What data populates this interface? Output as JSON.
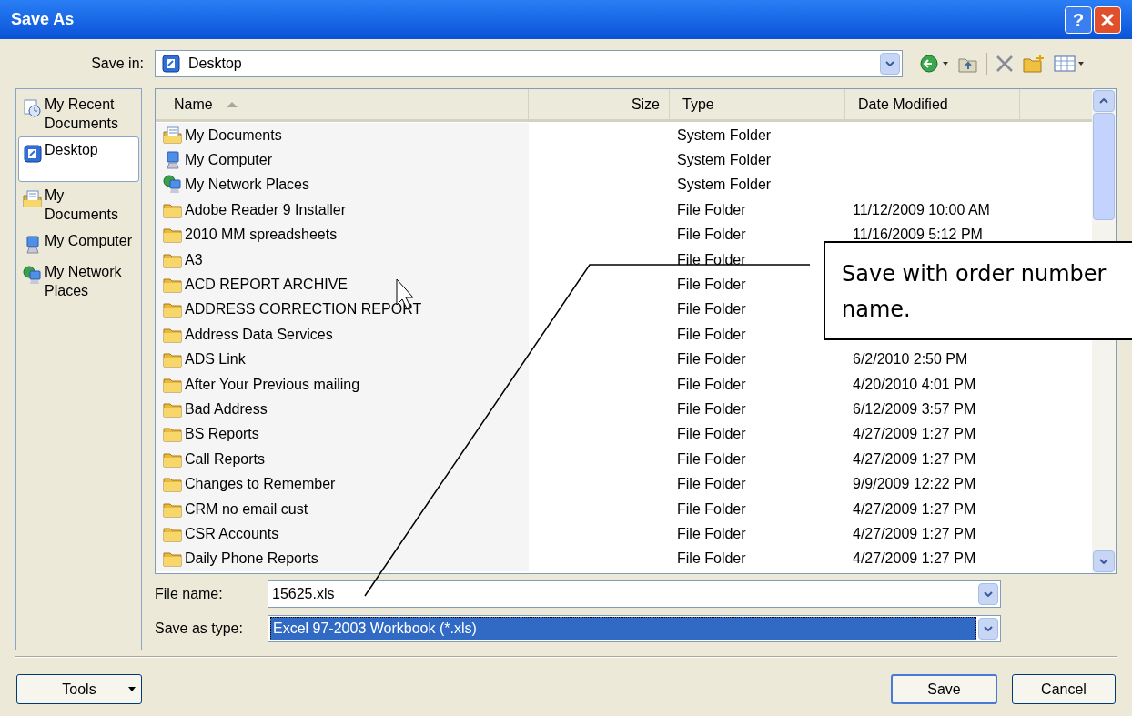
{
  "window": {
    "title": "Save As",
    "help_label": "?"
  },
  "save_in": {
    "label": "Save in:",
    "value": "Desktop"
  },
  "places": [
    {
      "label": "My Recent Documents",
      "kind": "recent",
      "selected": false
    },
    {
      "label": "Desktop",
      "kind": "desktop",
      "selected": true
    },
    {
      "label": "My Documents",
      "kind": "documents",
      "selected": false
    },
    {
      "label": "My Computer",
      "kind": "computer",
      "selected": false
    },
    {
      "label": "My Network Places",
      "kind": "network",
      "selected": false
    }
  ],
  "columns": [
    {
      "label": "Name",
      "sorted": true
    },
    {
      "label": "Size",
      "sorted": false
    },
    {
      "label": "Type",
      "sorted": false
    },
    {
      "label": "Date Modified",
      "sorted": false
    }
  ],
  "rows": [
    {
      "name": "My Documents",
      "kind": "documents",
      "type": "System Folder"
    },
    {
      "name": "My Computer",
      "kind": "computer",
      "type": "System Folder"
    },
    {
      "name": "My Network Places",
      "kind": "network",
      "type": "System Folder"
    },
    {
      "name": "Adobe Reader 9 Installer",
      "kind": "folder",
      "type": "File Folder",
      "date": "11/12/2009 10:00 AM"
    },
    {
      "name": "2010 MM spreadsheets",
      "kind": "folder",
      "type": "File Folder",
      "date": "11/16/2009 5:12 PM"
    },
    {
      "name": "A3",
      "kind": "folder",
      "type": "File Folder"
    },
    {
      "name": "ACD REPORT ARCHIVE",
      "kind": "folder",
      "type": "File Folder"
    },
    {
      "name": "ADDRESS CORRECTION REPORT",
      "kind": "folder",
      "type": "File Folder"
    },
    {
      "name": "Address Data Services",
      "kind": "folder",
      "type": "File Folder"
    },
    {
      "name": "ADS Link",
      "kind": "folder",
      "type": "File Folder",
      "date": "6/2/2010 2:50 PM"
    },
    {
      "name": "After Your Previous mailing",
      "kind": "folder",
      "type": "File Folder",
      "date": "4/20/2010 4:01 PM"
    },
    {
      "name": "Bad Address",
      "kind": "folder",
      "type": "File Folder",
      "date": "6/12/2009 3:57 PM"
    },
    {
      "name": "BS Reports",
      "kind": "folder",
      "type": "File Folder",
      "date": "4/27/2009 1:27 PM"
    },
    {
      "name": "Call Reports",
      "kind": "folder",
      "type": "File Folder",
      "date": "4/27/2009 1:27 PM"
    },
    {
      "name": "Changes to Remember",
      "kind": "folder",
      "type": "File Folder",
      "date": "9/9/2009 12:22 PM"
    },
    {
      "name": "CRM no email cust",
      "kind": "folder",
      "type": "File Folder",
      "date": "4/27/2009 1:27 PM"
    },
    {
      "name": "CSR Accounts",
      "kind": "folder",
      "type": "File Folder",
      "date": "4/27/2009 1:27 PM"
    },
    {
      "name": "Daily Phone Reports",
      "kind": "folder",
      "type": "File Folder",
      "date": "4/27/2009 1:27 PM"
    }
  ],
  "file_name": {
    "label": "File name:",
    "value": "15625.xls"
  },
  "save_as_type": {
    "label": "Save as type:",
    "value": "Excel 97-2003 Workbook (*.xls)",
    "highlighted": true
  },
  "buttons": {
    "tools": "Tools",
    "save": "Save",
    "cancel": "Cancel"
  },
  "callout": {
    "text": "Save with order number name."
  }
}
